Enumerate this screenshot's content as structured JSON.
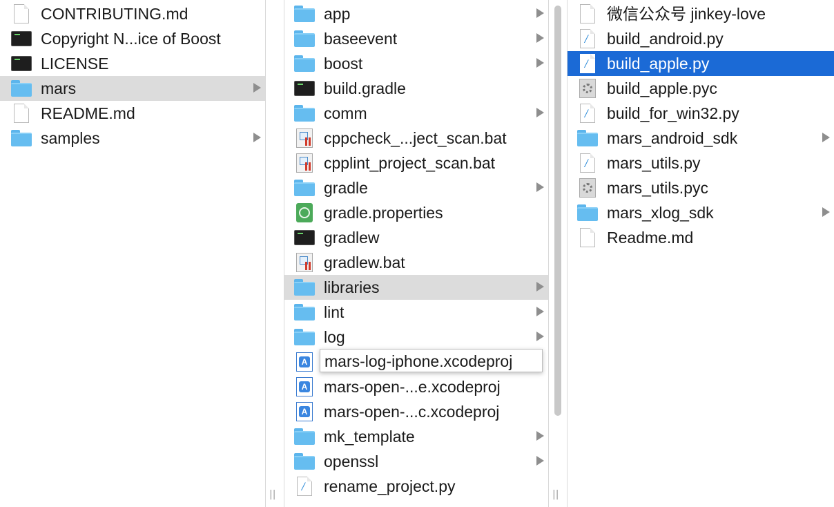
{
  "colors": {
    "selection_blue": "#1b6ad6",
    "selection_grey": "#dcdcdc",
    "folder_blue": "#66bdf0"
  },
  "columns": [
    {
      "name": "root",
      "items": [
        {
          "label": "CONTRIBUTING.md",
          "icon": "document-icon",
          "type": "file"
        },
        {
          "label": "Copyright N...ice of Boost",
          "icon": "terminal-icon",
          "type": "file"
        },
        {
          "label": "LICENSE",
          "icon": "terminal-icon",
          "type": "file"
        },
        {
          "label": "mars",
          "icon": "folder-icon",
          "type": "folder",
          "state": "selected-inactive"
        },
        {
          "label": "README.md",
          "icon": "document-icon",
          "type": "file"
        },
        {
          "label": "samples",
          "icon": "folder-icon",
          "type": "folder"
        }
      ]
    },
    {
      "name": "mars",
      "items": [
        {
          "label": "app",
          "icon": "folder-icon",
          "type": "folder"
        },
        {
          "label": "baseevent",
          "icon": "folder-icon",
          "type": "folder"
        },
        {
          "label": "boost",
          "icon": "folder-icon",
          "type": "folder"
        },
        {
          "label": "build.gradle",
          "icon": "terminal-icon",
          "type": "file"
        },
        {
          "label": "comm",
          "icon": "folder-icon",
          "type": "folder"
        },
        {
          "label": "cppcheck_...ject_scan.bat",
          "icon": "batch-file-icon",
          "type": "file"
        },
        {
          "label": "cpplint_project_scan.bat",
          "icon": "batch-file-icon",
          "type": "file"
        },
        {
          "label": "gradle",
          "icon": "folder-icon",
          "type": "folder"
        },
        {
          "label": "gradle.properties",
          "icon": "properties-icon",
          "type": "file"
        },
        {
          "label": "gradlew",
          "icon": "terminal-icon",
          "type": "file"
        },
        {
          "label": "gradlew.bat",
          "icon": "batch-file-icon",
          "type": "file"
        },
        {
          "label": "libraries",
          "icon": "folder-icon",
          "type": "folder",
          "state": "selected-inactive"
        },
        {
          "label": "lint",
          "icon": "folder-icon",
          "type": "folder"
        },
        {
          "label": "log",
          "icon": "folder-icon",
          "type": "folder"
        },
        {
          "label": "mars-log-iphone.xcodeproj",
          "icon": "xcode-project-icon",
          "type": "file"
        },
        {
          "label": "mars-open-...e.xcodeproj",
          "icon": "xcode-project-icon",
          "type": "file"
        },
        {
          "label": "mars-open-...c.xcodeproj",
          "icon": "xcode-project-icon",
          "type": "file"
        },
        {
          "label": "mk_template",
          "icon": "folder-icon",
          "type": "folder"
        },
        {
          "label": "openssl",
          "icon": "folder-icon",
          "type": "folder"
        },
        {
          "label": "rename_project.py",
          "icon": "python-script-icon",
          "type": "file"
        }
      ],
      "tooltip": "mars-log-iphone.xcodeproj"
    },
    {
      "name": "libraries",
      "items": [
        {
          "label": "微信公众号 jinkey-love",
          "icon": "document-icon",
          "type": "file"
        },
        {
          "label": "build_android.py",
          "icon": "python-script-icon",
          "type": "file"
        },
        {
          "label": "build_apple.py",
          "icon": "python-script-icon",
          "type": "file",
          "state": "selected-active"
        },
        {
          "label": "build_apple.pyc",
          "icon": "compiled-python-icon",
          "type": "file"
        },
        {
          "label": "build_for_win32.py",
          "icon": "python-script-icon",
          "type": "file"
        },
        {
          "label": "mars_android_sdk",
          "icon": "folder-icon",
          "type": "folder"
        },
        {
          "label": "mars_utils.py",
          "icon": "python-script-icon",
          "type": "file"
        },
        {
          "label": "mars_utils.pyc",
          "icon": "compiled-python-icon",
          "type": "file"
        },
        {
          "label": "mars_xlog_sdk",
          "icon": "folder-icon",
          "type": "folder"
        },
        {
          "label": "Readme.md",
          "icon": "document-icon",
          "type": "file"
        }
      ]
    }
  ],
  "column_resize_grip": "||"
}
